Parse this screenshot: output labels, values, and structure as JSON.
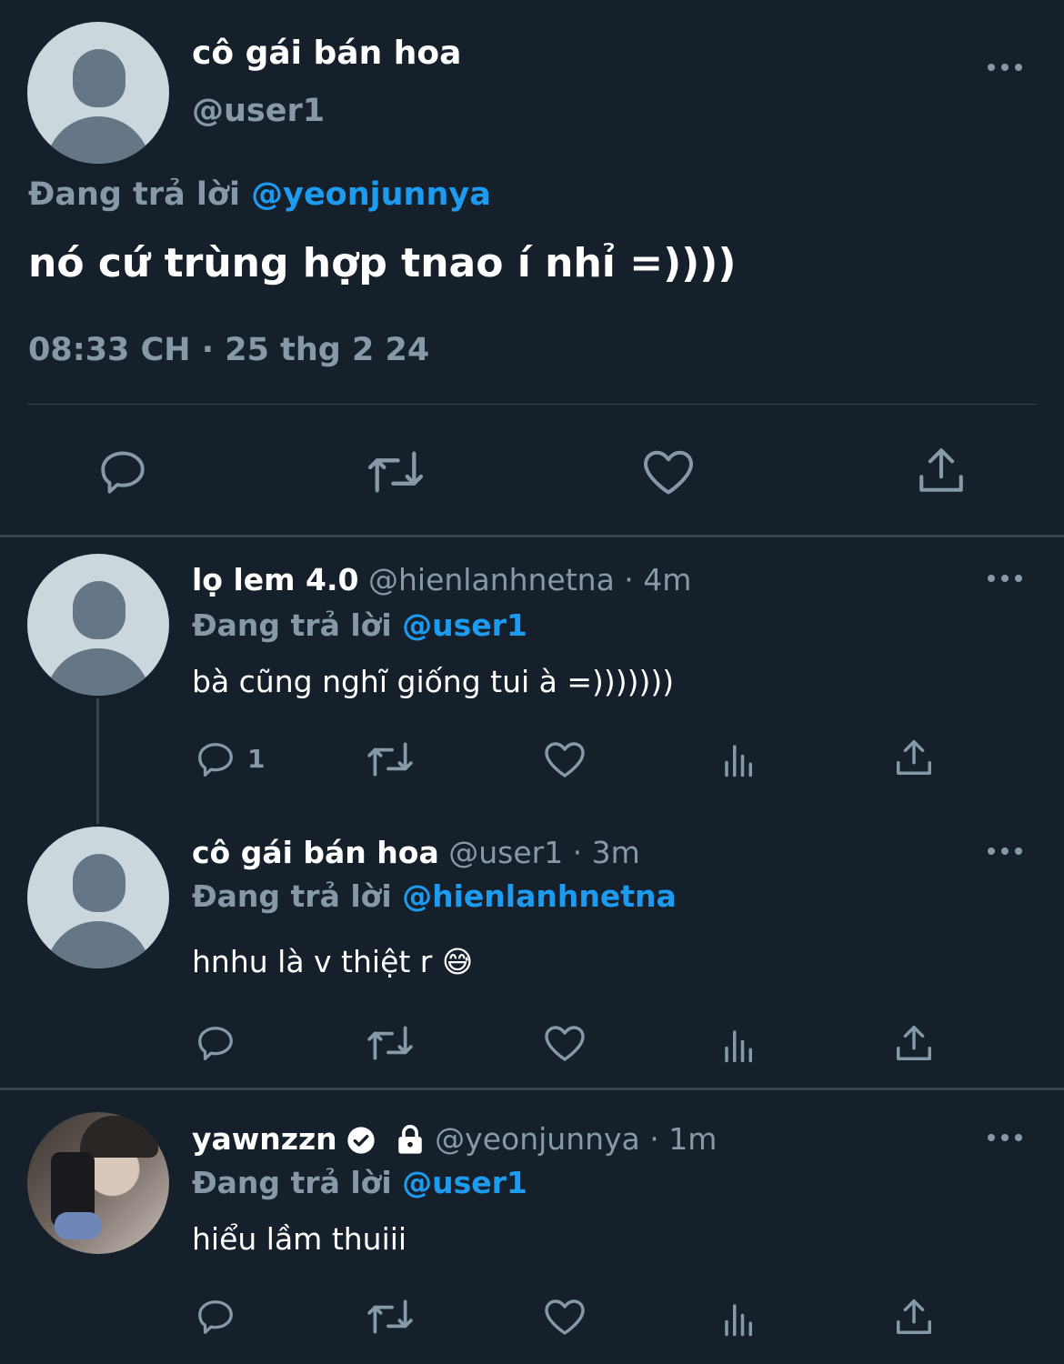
{
  "main": {
    "name": "cô gái bán hoa",
    "handle": "@user1",
    "replying_prefix": "Đang trả lời",
    "replying_to": "@yeonjunnya",
    "text": "nó cứ trùng hợp tnao í nhỉ =))))",
    "timestamp": "08:33 CH · 25 thg 2 24"
  },
  "replies": [
    {
      "name": "lọ lem 4.0",
      "handle_time": "@hienlanhnetna · 4m",
      "replying_prefix": "Đang trả lời",
      "replying_to": "@user1",
      "text": "bà cũng nghĩ giống tui à =)))))))",
      "reply_count": "1"
    },
    {
      "name": "cô gái bán hoa",
      "handle_time": "@user1 · 3m",
      "replying_prefix": "Đang trả lời",
      "replying_to": "@hienlanhnetna",
      "text": "hnhu là v thiệt r 😅",
      "reply_count": ""
    },
    {
      "name": "yawnzzn",
      "handle_time": "@yeonjunnya · 1m",
      "replying_prefix": "Đang trả lời",
      "replying_to": "@user1",
      "text": "hiểu lầm thuiii",
      "reply_count": ""
    }
  ],
  "colors": {
    "background": "#15202b",
    "muted": "#8899a6",
    "link": "#1d9bf0",
    "separator": "#38444d"
  },
  "icons": [
    "more-icon",
    "reply-icon",
    "retweet-icon",
    "like-icon",
    "analytics-icon",
    "share-icon",
    "verified-icon",
    "lock-icon"
  ]
}
